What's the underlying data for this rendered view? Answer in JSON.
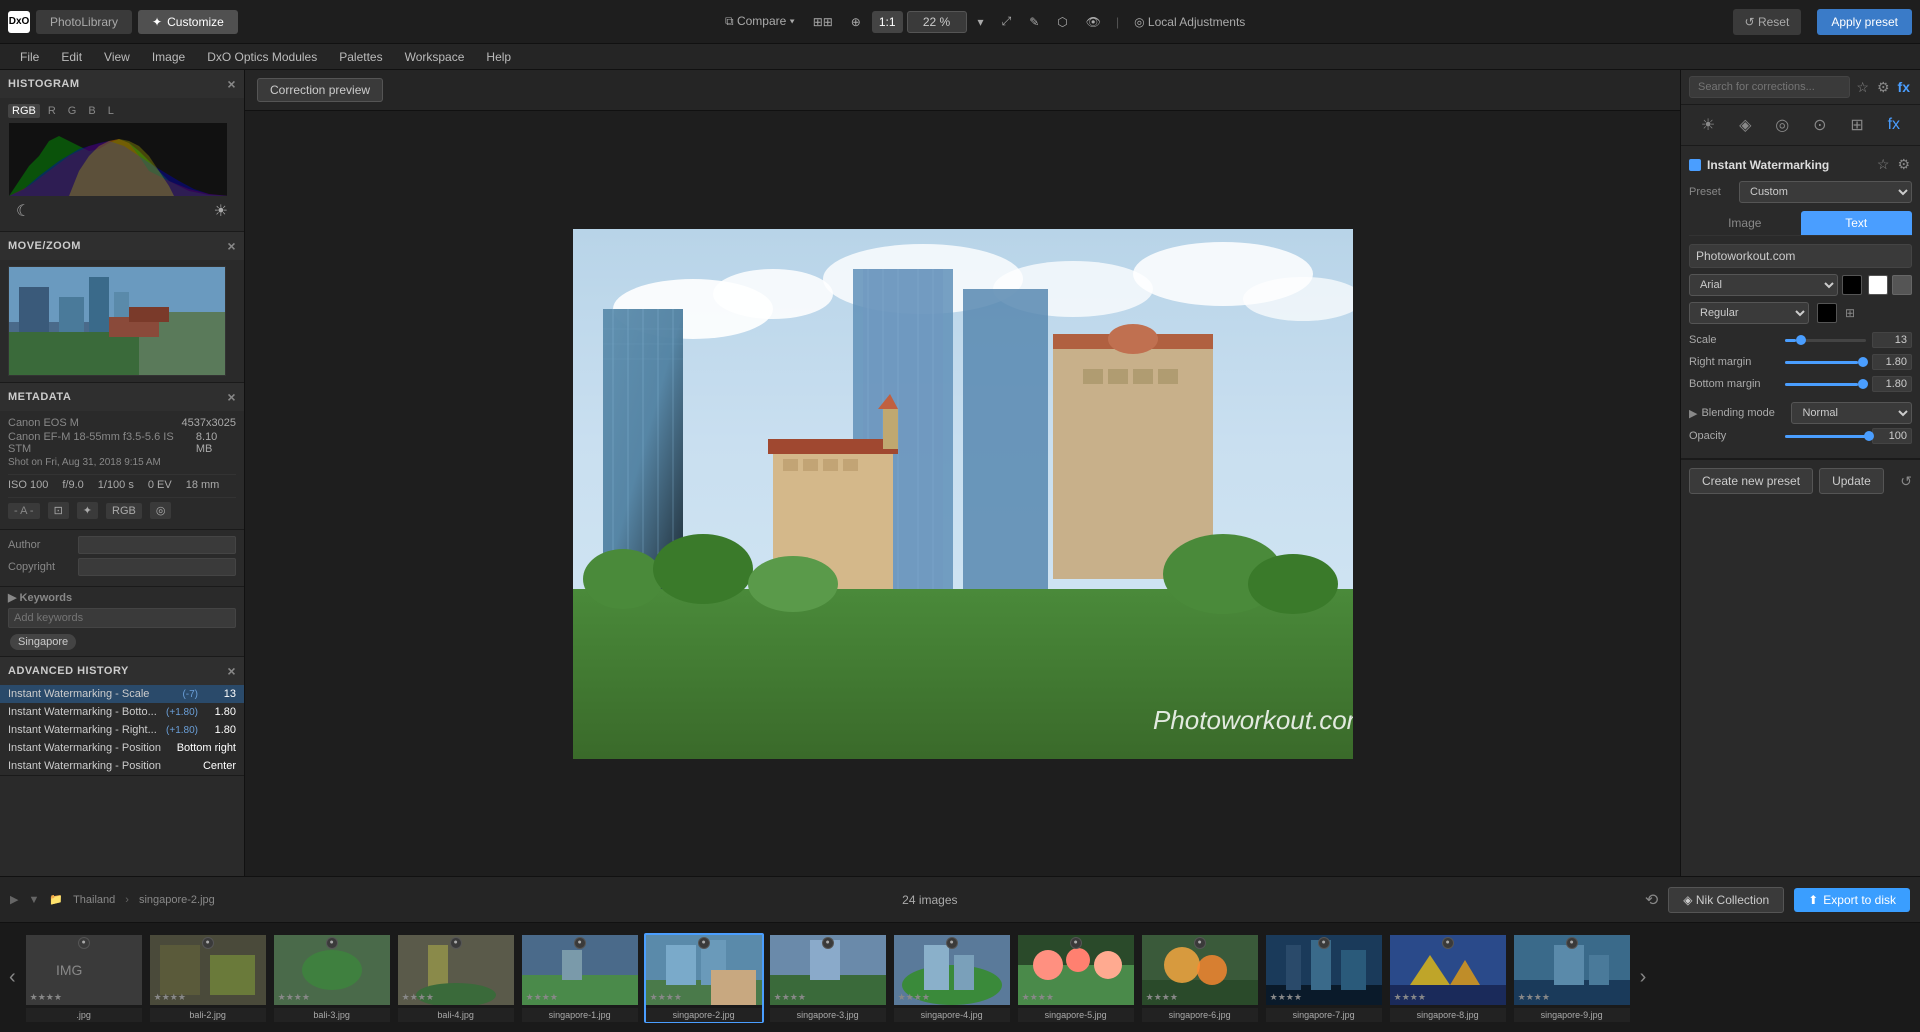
{
  "app": {
    "logo": "DxO",
    "logo_icon": "■",
    "app_name": "PhotoLibrary",
    "customize_label": "Customize",
    "photolibrary_label": "PhotoLibrary"
  },
  "menubar": {
    "items": [
      "File",
      "Edit",
      "View",
      "Image",
      "DxO Optics Modules",
      "Palettes",
      "Workspace",
      "Help"
    ]
  },
  "toolbar": {
    "compare_label": "Compare",
    "zoom_label": "22 %",
    "local_adjustments_label": "Local Adjustments",
    "reset_label": "Reset",
    "apply_preset_label": "Apply preset",
    "one_to_one": "1:1"
  },
  "left_panel": {
    "histogram_title": "HISTOGRAM",
    "histogram_tabs": [
      "RGB",
      "R",
      "G",
      "B",
      "L"
    ],
    "active_tab": "RGB",
    "minimap_title": "MOVE/ZOOM",
    "metadata_title": "METADATA",
    "camera": "Canon EOS M",
    "resolution": "4537x3025",
    "lens": "Canon EF-M 18-55mm f3.5-5.6 IS STM",
    "filesize": "8.10 MB",
    "shot_date": "Shot on Fri, Aug 31, 2018 9:15 AM",
    "iso": "ISO 100",
    "aperture": "f/9.0",
    "shutter": "1/100 s",
    "ev": "0 EV",
    "focal": "18 mm",
    "color_space": "RGB",
    "author_title": "Author",
    "copyright_title": "Copyright",
    "keywords_title": "Keywords",
    "add_keywords_placeholder": "Add keywords",
    "kw_tag": "Singapore",
    "history_title": "ADVANCED HISTORY",
    "history_items": [
      {
        "name": "Instant Watermarking - Scale",
        "delta": "(-7)",
        "value": "13"
      },
      {
        "name": "Instant Watermarking - Botto...",
        "delta": "(+1.80)",
        "value": "1.80"
      },
      {
        "name": "Instant Watermarking - Right...",
        "delta": "(+1.80)",
        "value": "1.80"
      },
      {
        "name": "Instant Watermarking - Position",
        "delta": "",
        "value": "Bottom right"
      },
      {
        "name": "Instant Watermarking - Position",
        "delta": "",
        "value": "Center"
      }
    ]
  },
  "center": {
    "correction_preview_label": "Correction preview",
    "watermark_text": "Photoworkout.com"
  },
  "right_panel": {
    "search_placeholder": "Search for corrections...",
    "section_title": "Instant Watermarking",
    "preset_label": "Preset",
    "preset_value": "Custom",
    "tab_image": "Image",
    "tab_text": "Text",
    "text_value": "Photoworkout.com",
    "font_label": "Arial",
    "style_label": "Regular",
    "scale_label": "Scale",
    "scale_value": "13",
    "scale_percent": 13,
    "right_margin_label": "Right margin",
    "right_margin_value": "1.80",
    "right_margin_percent": 90,
    "bottom_margin_label": "Bottom margin",
    "bottom_margin_value": "1.80",
    "bottom_margin_percent": 90,
    "blending_label": "Blending mode",
    "blending_value": "Normal",
    "opacity_label": "Opacity",
    "opacity_value": "100",
    "opacity_percent": 100,
    "create_preset_label": "Create new preset",
    "update_label": "Update"
  },
  "filmstrip": {
    "path_parts": [
      "Thailand",
      "singapore-2.jpg"
    ],
    "count_text": "24 images",
    "nik_label": "Nik Collection",
    "export_label": "Export to disk",
    "items": [
      {
        "label": ".jpg",
        "active": false
      },
      {
        "label": "bali-2.jpg",
        "active": false
      },
      {
        "label": "bali-3.jpg",
        "active": false
      },
      {
        "label": "bali-4.jpg",
        "active": false
      },
      {
        "label": "singapore-1.jpg",
        "active": false
      },
      {
        "label": "singapore-2.jpg",
        "active": true
      },
      {
        "label": "singapore-3.jpg",
        "active": false
      },
      {
        "label": "singapore-4.jpg",
        "active": false
      },
      {
        "label": "singapore-5.jpg",
        "active": false
      },
      {
        "label": "singapore-6.jpg",
        "active": false
      },
      {
        "label": "singapore-7.jpg",
        "active": false
      },
      {
        "label": "singapore-8.jpg",
        "active": false
      },
      {
        "label": "singapore-9.jpg",
        "active": false
      }
    ]
  }
}
